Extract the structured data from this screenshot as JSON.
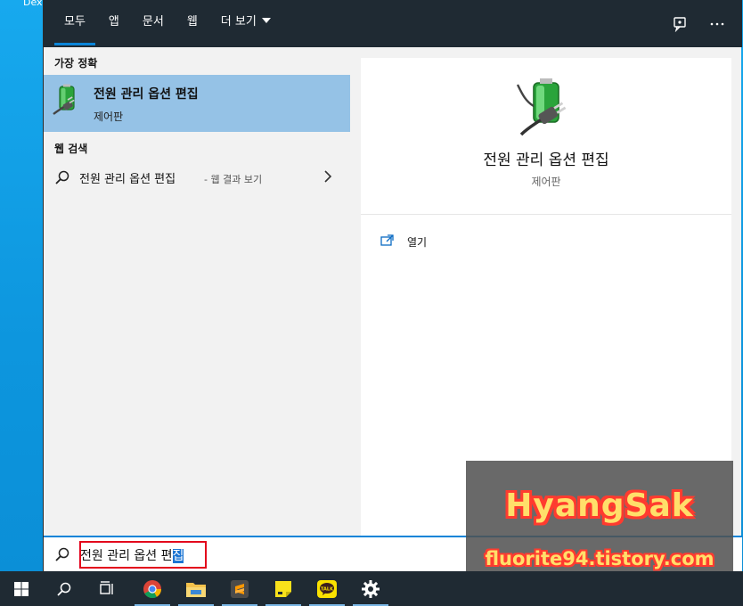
{
  "desktop": {
    "corner_label": "Dex"
  },
  "tabs": [
    {
      "label": "모두",
      "active": true
    },
    {
      "label": "앱"
    },
    {
      "label": "문서"
    },
    {
      "label": "웹"
    },
    {
      "label": "더 보기"
    }
  ],
  "top_icons": [
    "feedback-icon",
    "more-options-icon"
  ],
  "left": {
    "best_match_header": "가장 정확",
    "best_match": {
      "title": "전원 관리 옵션 편집",
      "subtitle": "제어판",
      "icon": "power-plug-battery-icon"
    },
    "web_header": "웹 검색",
    "web_result": {
      "main": "전원 관리 옵션 편집",
      "suffix": "- 웹 결과 보기"
    }
  },
  "preview": {
    "title": "전원 관리 옵션 편집",
    "subtitle": "제어판",
    "action_open": "열기"
  },
  "search": {
    "text_before": "전원 관리 옵션 편",
    "text_selected": "집"
  },
  "watermark": {
    "title": "HyangSak",
    "url": "fluorite94.tistory.com"
  },
  "taskbar": [
    "windows-start-icon",
    "search-icon",
    "task-view-icon",
    "chrome-icon",
    "file-explorer-icon",
    "sublime-text-icon",
    "sticky-notes-icon",
    "kakaotalk-icon",
    "settings-gear-icon"
  ],
  "colors": {
    "accent": "#0a84d8",
    "selected_row": "#95c2e6",
    "topbar": "#1f2a33",
    "highlight_outline": "#e3001b"
  }
}
